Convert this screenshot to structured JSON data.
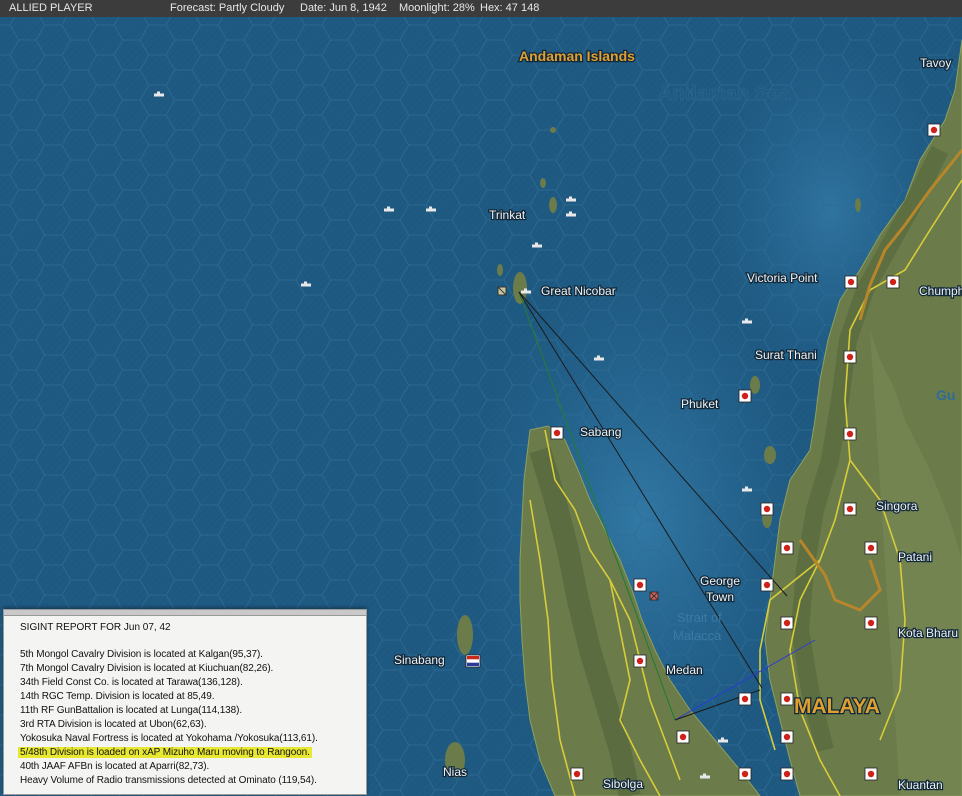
{
  "topbar": {
    "player": "ALLIED PLAYER",
    "forecast": "Forecast: Partly Cloudy",
    "date": "Date: Jun 8, 1942",
    "moonlight": "Moonlight: 28%",
    "hex": "Hex: 47  148"
  },
  "map": {
    "sea_label": "Andaman Sea",
    "region_label": "Andaman Islands",
    "country_label": "MALAYA",
    "strait_label_line1": "Strait of",
    "strait_label_line2": "Malacca",
    "edge_label": "Gu",
    "places": {
      "tavoy": "Tavoy",
      "trinkat": "Trinkat",
      "great_nicobar": "Great Nicobar",
      "victoria_point": "Victoria Point",
      "chumphon": "Chumph",
      "surat_thani": "Surat Thani",
      "phuket": "Phuket",
      "sabang": "Sabang",
      "singora": "Singora",
      "patani": "Patani",
      "george_town_1": "George",
      "george_town_2": "Town",
      "kota_bharu": "Kota Bharu",
      "sinabang": "Sinabang",
      "medan": "Medan",
      "nias": "Nias",
      "sibolga": "Sibolga",
      "kuantan": "Kuantan"
    }
  },
  "report": {
    "title": "SIGINT REPORT FOR Jun 07, 42",
    "lines": [
      "5th Mongol Cavalry Division is located at Kalgan(95,37).",
      "7th Mongol Cavalry Division is located at Kiuchuan(82,26).",
      "34th Field Const Co. is located at Tarawa(136,128).",
      "14th RGC Temp. Division is located at 85,49.",
      "11th RF GunBattalion is located at Lunga(114,138).",
      "3rd RTA Division is located at Ubon(62,63).",
      "Yokosuka Naval Fortress is located at Yokohama /Yokosuka(113,61).",
      "5/48th Division is loaded on xAP Mizuho Maru moving to Rangoon.",
      "40th JAAF AFBn  is located at Aparri(82,73).",
      "Heavy Volume of Radio transmissions detected at Ominato (119,54)."
    ]
  },
  "colors": {
    "sea": "#1f5a82",
    "land": "#6f7e4c",
    "report_highlight": "#e8e832",
    "orange_label": "#e0a030"
  }
}
